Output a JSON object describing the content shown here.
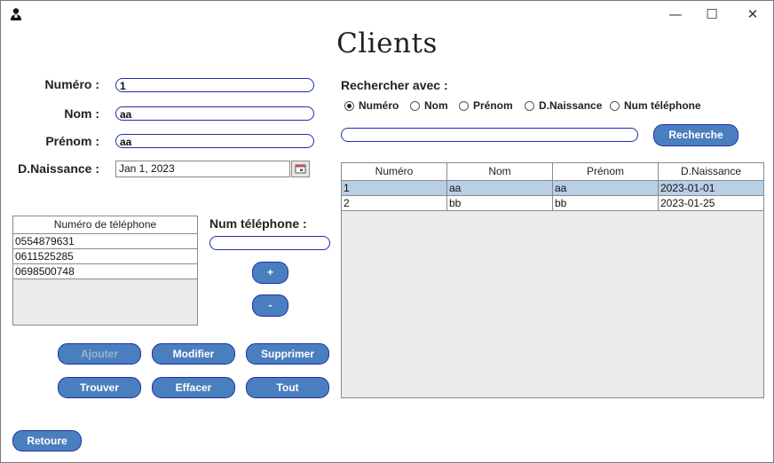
{
  "window": {
    "app_icon": "user-icon",
    "controls": {
      "minimize": "—",
      "maximize": "☐",
      "close": "✕"
    }
  },
  "title": "Clients",
  "form": {
    "numero_label": "Numéro :",
    "numero_value": "1",
    "nom_label": "Nom :",
    "nom_value": "aa",
    "prenom_label": "Prénom :",
    "prenom_value": "aa",
    "naissance_label": "D.Naissance :",
    "naissance_value": "Jan 1, 2023",
    "calendar_icon": "calendar-icon"
  },
  "phones": {
    "header": "Numéro de téléphone",
    "rows": [
      "0554879631",
      "0611525285",
      "0698500748"
    ],
    "input_label": "Num téléphone :",
    "input_value": "",
    "add_label": "+",
    "remove_label": "-"
  },
  "actions": {
    "ajouter": "Ajouter",
    "modifier": "Modifier",
    "supprimer": "Supprimer",
    "trouver": "Trouver",
    "effacer": "Effacer",
    "tout": "Tout",
    "retour": "Retoure"
  },
  "search": {
    "label": "Rechercher avec :",
    "options": [
      "Numéro",
      "Nom",
      "Prénom",
      "D.Naissance",
      "Num téléphone"
    ],
    "selected": "Numéro",
    "value": "",
    "button": "Recherche"
  },
  "results": {
    "columns": [
      "Numéro",
      "Nom",
      "Prénom",
      "D.Naissance"
    ],
    "rows": [
      [
        "1",
        "aa",
        "aa",
        "2023-01-01"
      ],
      [
        "2",
        "bb",
        "bb",
        "2023-01-25"
      ]
    ],
    "selected_row": 0
  },
  "colors": {
    "button_fill": "#4a7fbf",
    "field_border": "#1e2fa8",
    "selected_row": "#b8cfe6"
  }
}
